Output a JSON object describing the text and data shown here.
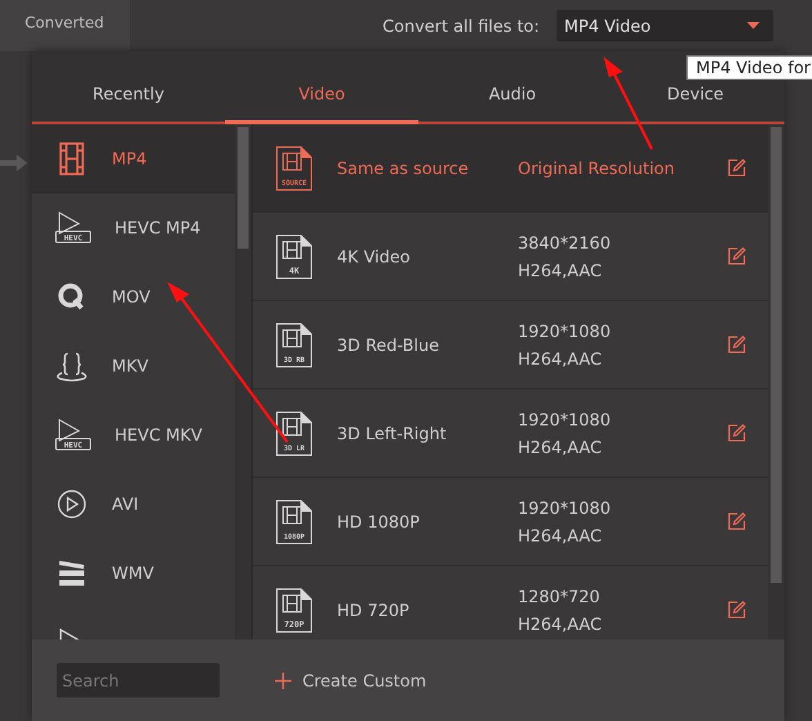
{
  "top_bar": {
    "tab": "Converted",
    "convert_label": "Convert all files to:",
    "format_dropdown": "MP4 Video"
  },
  "tooltip": "MP4 Video for",
  "tabs": [
    {
      "label": "Recently",
      "selected": false
    },
    {
      "label": "Video",
      "selected": true
    },
    {
      "label": "Audio",
      "selected": false
    },
    {
      "label": "Device",
      "selected": false
    }
  ],
  "formats": [
    {
      "name": "MP4",
      "kind": "film",
      "selected": true
    },
    {
      "name": "HEVC MP4",
      "kind": "hevc",
      "badge": "HEVC",
      "selected": false
    },
    {
      "name": "MOV",
      "kind": "quicktime",
      "selected": false
    },
    {
      "name": "MKV",
      "kind": "braces",
      "selected": false
    },
    {
      "name": "HEVC MKV",
      "kind": "hevc",
      "badge": "HEVC",
      "selected": false
    },
    {
      "name": "AVI",
      "kind": "circle-play",
      "selected": false
    },
    {
      "name": "WMV",
      "kind": "clapper",
      "selected": false
    },
    {
      "kind": "play",
      "selected": false
    }
  ],
  "presets": [
    {
      "name": "Same as source",
      "badge": "SOURCE",
      "resolution": "Original Resolution",
      "selected": true
    },
    {
      "name": "4K Video",
      "badge": "4K",
      "resolution": "3840*2160",
      "codec": "H264,AAC",
      "selected": false
    },
    {
      "name": "3D Red-Blue",
      "badge": "3D RB",
      "resolution": "1920*1080",
      "codec": "H264,AAC",
      "selected": false
    },
    {
      "name": "3D Left-Right",
      "badge": "3D LR",
      "resolution": "1920*1080",
      "codec": "H264,AAC",
      "selected": false
    },
    {
      "name": "HD 1080P",
      "badge": "1080P",
      "resolution": "1920*1080",
      "codec": "H264,AAC",
      "selected": false
    },
    {
      "name": "HD 720P",
      "badge": "720P",
      "resolution": "1280*720",
      "codec": "H264,AAC",
      "selected": false
    }
  ],
  "search": {
    "placeholder": "Search"
  },
  "create_custom": "Create Custom"
}
